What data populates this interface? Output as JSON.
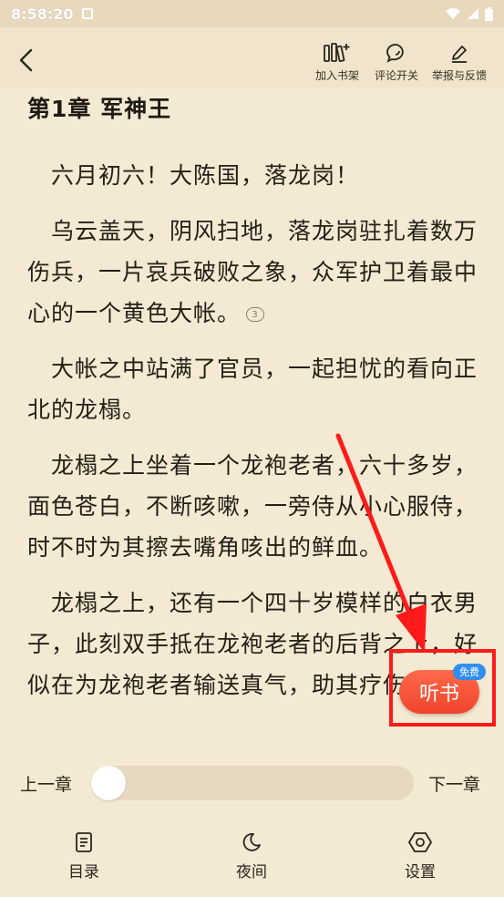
{
  "status_bar": {
    "time": "8:58:20"
  },
  "top_bar": {
    "actions": [
      {
        "label": "加入书架",
        "icon": "bookshelf-add-icon"
      },
      {
        "label": "评论开关",
        "icon": "comment-toggle-icon"
      },
      {
        "label": "举报与反馈",
        "icon": "report-feedback-icon"
      }
    ]
  },
  "reader": {
    "chapter_title": "第1章  军神王",
    "paragraphs": [
      "六月初六！大陈国，落龙岗！",
      "乌云盖天，阴风扫地，落龙岗驻扎着数万伤兵，一片哀兵破败之象，众军护卫着最中心的一个黄色大帐。",
      "大帐之中站满了官员，一起担忧的看向正北的龙榻。",
      "龙榻之上坐着一个龙袍老者，六十多岁，面色苍白，不断咳嗽，一旁侍从小心服侍，时不时为其擦去嘴角咳出的鲜血。",
      "龙榻之上，还有一个四十岁模样的白衣男子，此刻双手抵在龙袍老者的后背之上，好似在为龙袍老者输送真气，助其疗伤一般。"
    ],
    "comment_count": "3"
  },
  "listen": {
    "label": "听书",
    "badge": "免费"
  },
  "progress": {
    "prev_label": "上一章",
    "next_label": "下一章",
    "value_fraction": 0.0
  },
  "bottom_bar": {
    "items": [
      {
        "label": "目录",
        "icon": "catalog-icon"
      },
      {
        "label": "夜间",
        "icon": "night-mode-icon"
      },
      {
        "label": "设置",
        "icon": "settings-icon"
      }
    ]
  },
  "colors": {
    "page_bg": "#f4e9d3",
    "highlight_red": "#ff1a1a",
    "listen_orange": "#f0442c",
    "badge_blue": "#2f8ef0"
  }
}
